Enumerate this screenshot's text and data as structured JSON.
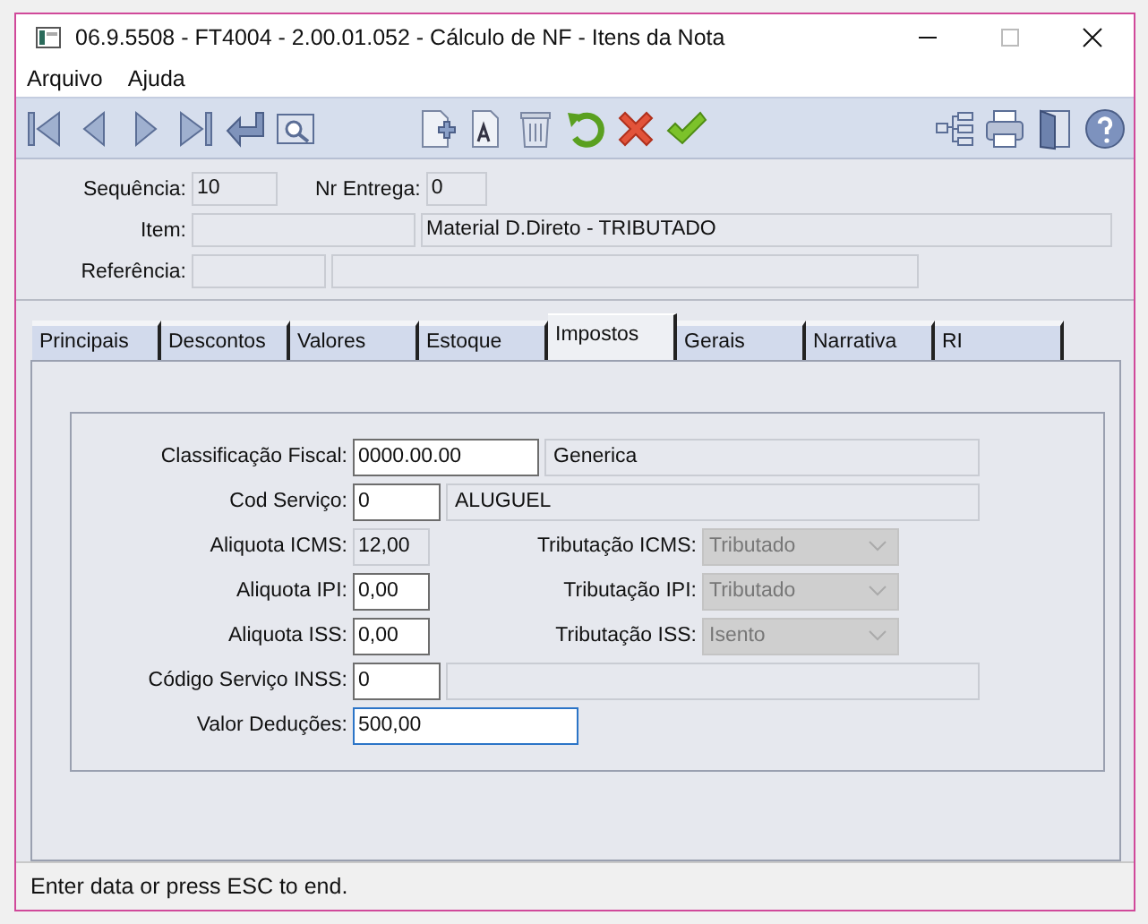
{
  "window": {
    "title": "06.9.5508 - FT4004 - 2.00.01.052 - Cálculo de NF - Itens da Nota"
  },
  "menu": [
    "Arquivo",
    "Ajuda"
  ],
  "header": {
    "sequencia": {
      "label": "Sequência:",
      "value": "10"
    },
    "nr_entrega": {
      "label": "Nr Entrega:",
      "value": "0"
    },
    "item": {
      "label": "Item:",
      "description": "Material D.Direto - TRIBUTADO"
    },
    "referencia": {
      "label": "Referência:"
    }
  },
  "tabs": [
    {
      "label": "Principais",
      "selected": false
    },
    {
      "label": "Descontos",
      "selected": false
    },
    {
      "label": "Valores",
      "selected": false
    },
    {
      "label": "Estoque",
      "selected": false
    },
    {
      "label": "Impostos",
      "selected": true
    },
    {
      "label": "Gerais",
      "selected": false
    },
    {
      "label": "Narrativa",
      "selected": false
    },
    {
      "label": "RI",
      "selected": false
    }
  ],
  "fields": [
    {
      "kind": "with-description",
      "label": "Classificação Fiscal:",
      "value": "0000.00.00",
      "editable": true,
      "focused": false,
      "description": "Generica"
    },
    {
      "kind": "with-description",
      "label": "Cod Serviço:",
      "value": "0",
      "editable": true,
      "focused": false,
      "description": "ALUGUEL"
    },
    {
      "kind": "with-select",
      "label": "Aliquota ICMS:",
      "value": "12,00",
      "editable": false,
      "focused": false,
      "select": {
        "label": "Tributação ICMS:",
        "value": "Tributado",
        "disabled": true
      }
    },
    {
      "kind": "with-select",
      "label": "Aliquota IPI:",
      "value": "0,00",
      "editable": true,
      "focused": false,
      "select": {
        "label": "Tributação IPI:",
        "value": "Tributado",
        "disabled": true
      }
    },
    {
      "kind": "with-select",
      "label": "Aliquota ISS:",
      "value": "0,00",
      "editable": true,
      "focused": false,
      "select": {
        "label": "Tributação ISS:",
        "value": "Isento",
        "disabled": true
      }
    },
    {
      "kind": "with-description",
      "label": "Código Serviço INSS:",
      "value": "0",
      "editable": true,
      "focused": false
    },
    {
      "kind": "wide",
      "label": "Valor Deduções:",
      "value": "500,00",
      "editable": true,
      "focused": true
    }
  ],
  "status_bar": "Enter data or press ESC to end."
}
